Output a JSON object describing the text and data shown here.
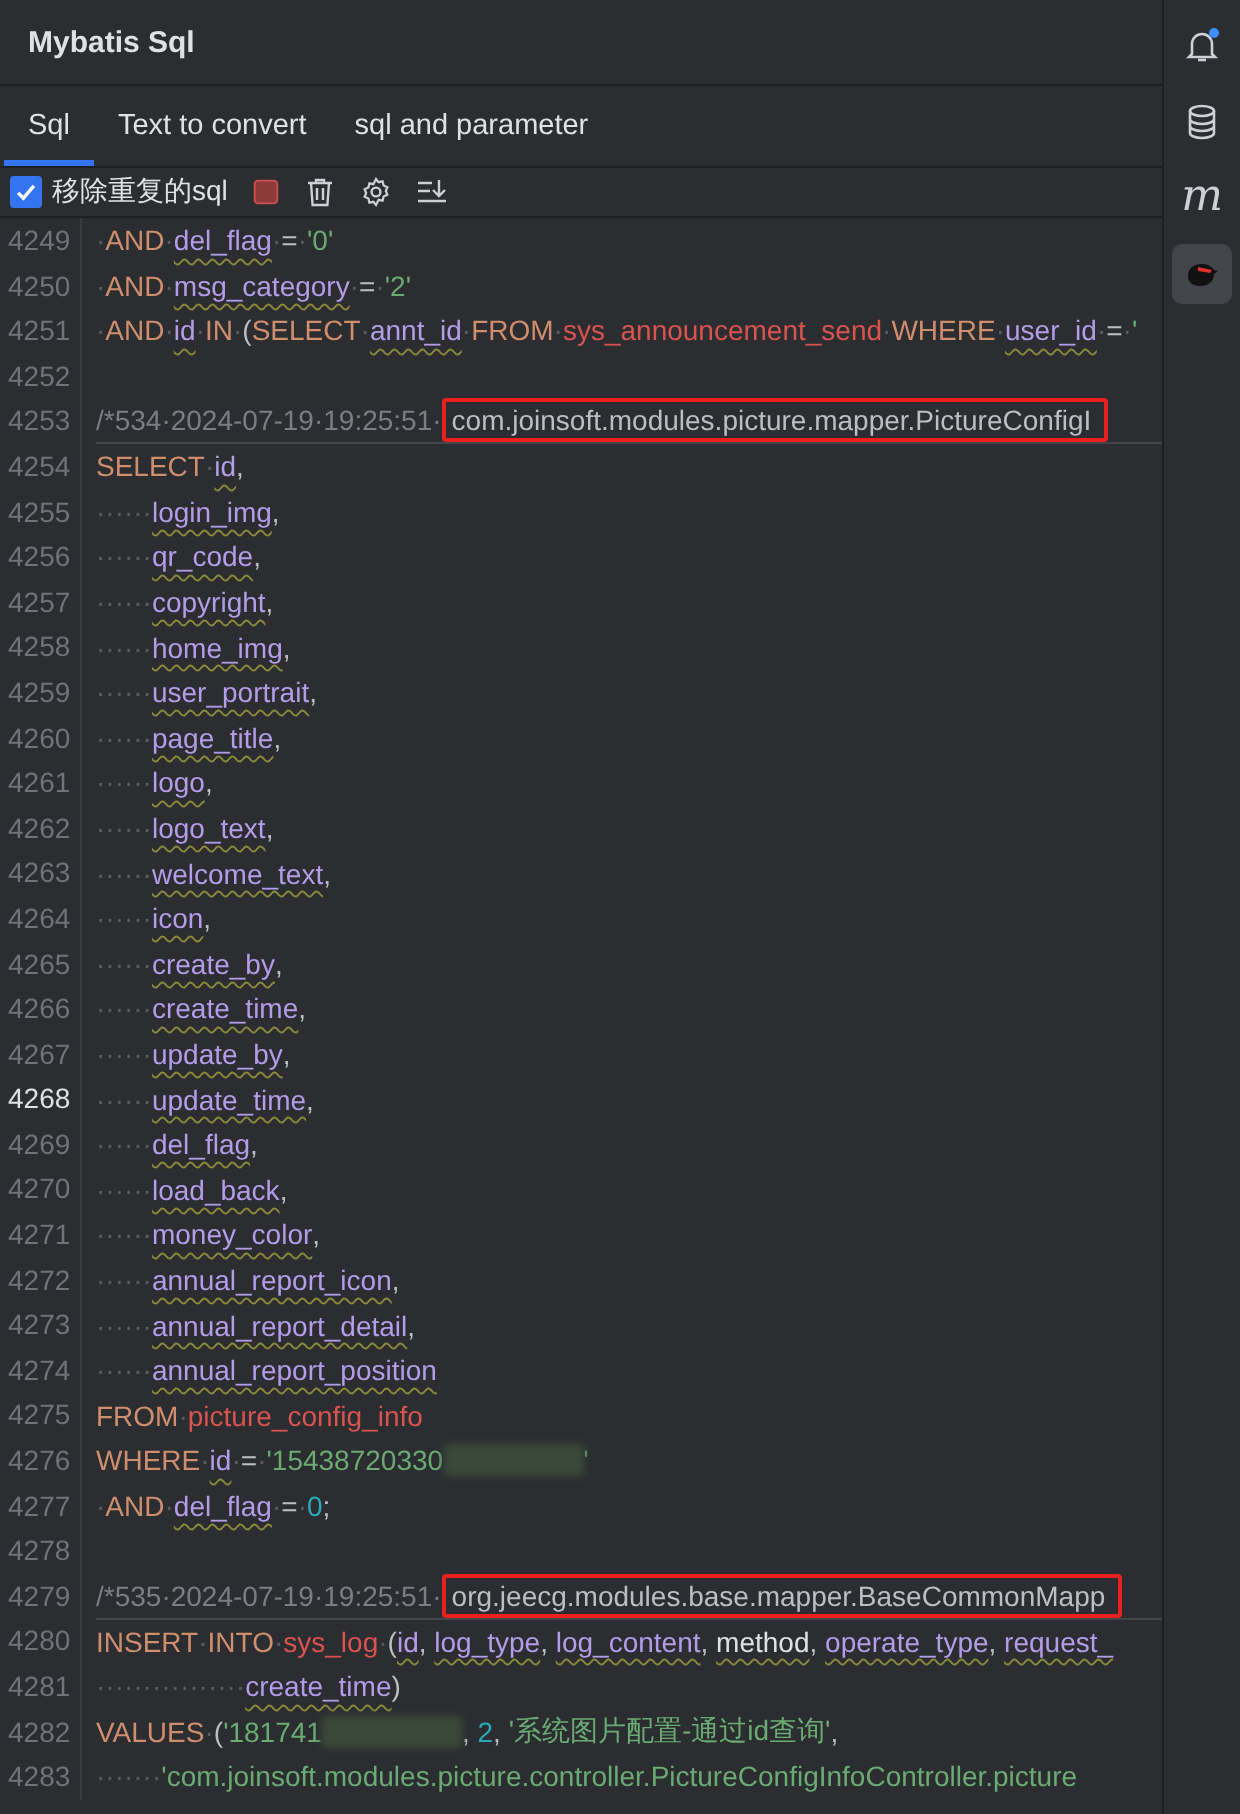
{
  "panel": {
    "title": "Mybatis Sql"
  },
  "tabs": [
    {
      "label": "Sql",
      "selected": true
    },
    {
      "label": "Text to convert",
      "selected": false
    },
    {
      "label": "sql and parameter",
      "selected": false
    }
  ],
  "toolbar": {
    "remove_duplicates": {
      "label": "移除重复的sql",
      "checked": true
    }
  },
  "side_strip": {
    "bell_badge": true,
    "items": [
      {
        "kind": "bell",
        "selected": false
      },
      {
        "kind": "database",
        "selected": false
      },
      {
        "kind": "letter",
        "text": "m",
        "selected": false
      },
      {
        "kind": "bird",
        "selected": true
      }
    ]
  },
  "lines": [
    {
      "number": "4249",
      "current": false,
      "boxed": false,
      "tokens": [
        {
          "kind": "ws",
          "text": "·"
        },
        {
          "kind": "kw",
          "text": "AND"
        },
        {
          "kind": "ws",
          "text": "·"
        },
        {
          "kind": "id",
          "text": "del_flag"
        },
        {
          "kind": "ws",
          "text": "·"
        },
        {
          "kind": "op",
          "text": "="
        },
        {
          "kind": "ws",
          "text": "·"
        },
        {
          "kind": "str",
          "text": "'0'"
        }
      ]
    },
    {
      "number": "4250",
      "current": false,
      "boxed": false,
      "tokens": [
        {
          "kind": "ws",
          "text": "·"
        },
        {
          "kind": "kw",
          "text": "AND"
        },
        {
          "kind": "ws",
          "text": "·"
        },
        {
          "kind": "id",
          "text": "msg_category"
        },
        {
          "kind": "ws",
          "text": "·"
        },
        {
          "kind": "op",
          "text": "="
        },
        {
          "kind": "ws",
          "text": "·"
        },
        {
          "kind": "str",
          "text": "'2'"
        }
      ]
    },
    {
      "number": "4251",
      "current": false,
      "boxed": false,
      "tokens": [
        {
          "kind": "ws",
          "text": "·"
        },
        {
          "kind": "kw",
          "text": "AND"
        },
        {
          "kind": "ws",
          "text": "·"
        },
        {
          "kind": "id",
          "text": "id"
        },
        {
          "kind": "ws",
          "text": "·"
        },
        {
          "kind": "kw",
          "text": "IN"
        },
        {
          "kind": "ws",
          "text": "·"
        },
        {
          "kind": "op",
          "text": "("
        },
        {
          "kind": "kw",
          "text": "SELECT"
        },
        {
          "kind": "ws",
          "text": "·"
        },
        {
          "kind": "id",
          "text": "annt_id"
        },
        {
          "kind": "ws",
          "text": "·"
        },
        {
          "kind": "kw",
          "text": "FROM"
        },
        {
          "kind": "ws",
          "text": "·"
        },
        {
          "kind": "table",
          "text": "sys_announcement_send"
        },
        {
          "kind": "ws",
          "text": "·"
        },
        {
          "kind": "kw",
          "text": "WHERE"
        },
        {
          "kind": "ws",
          "text": "·"
        },
        {
          "kind": "id",
          "text": "user_id"
        },
        {
          "kind": "ws",
          "text": "·"
        },
        {
          "kind": "op",
          "text": "="
        },
        {
          "kind": "ws",
          "text": "·"
        },
        {
          "kind": "str",
          "text": "'"
        }
      ]
    },
    {
      "number": "4252",
      "current": false
    },
    {
      "number": "4253",
      "current": false,
      "boxed": true,
      "tokens": [
        {
          "kind": "comment",
          "text": "/*534·2024-07-19·19:25:51·"
        },
        {
          "kind": "boxed",
          "text": "com.joinsoft.modules.picture.mapper.PictureConfigI"
        }
      ]
    },
    {
      "number": "4254",
      "current": false,
      "boxed": false,
      "tokens": [
        {
          "kind": "kw",
          "text": "SELECT"
        },
        {
          "kind": "ws",
          "text": "·"
        },
        {
          "kind": "id",
          "text": "id"
        },
        {
          "kind": "op",
          "text": ","
        }
      ]
    },
    {
      "number": "4255",
      "current": false,
      "boxed": false,
      "tokens": [
        {
          "kind": "ws",
          "text": "······"
        },
        {
          "kind": "id",
          "text": "login_img"
        },
        {
          "kind": "op",
          "text": ","
        }
      ]
    },
    {
      "number": "4256",
      "current": false,
      "boxed": false,
      "tokens": [
        {
          "kind": "ws",
          "text": "······"
        },
        {
          "kind": "id",
          "text": "qr_code"
        },
        {
          "kind": "op",
          "text": ","
        }
      ]
    },
    {
      "number": "4257",
      "current": false,
      "boxed": false,
      "tokens": [
        {
          "kind": "ws",
          "text": "······"
        },
        {
          "kind": "id",
          "text": "copyright"
        },
        {
          "kind": "op",
          "text": ","
        }
      ]
    },
    {
      "number": "4258",
      "current": false,
      "boxed": false,
      "tokens": [
        {
          "kind": "ws",
          "text": "······"
        },
        {
          "kind": "id",
          "text": "home_img"
        },
        {
          "kind": "op",
          "text": ","
        }
      ]
    },
    {
      "number": "4259",
      "current": false,
      "boxed": false,
      "tokens": [
        {
          "kind": "ws",
          "text": "······"
        },
        {
          "kind": "id",
          "text": "user_portrait"
        },
        {
          "kind": "op",
          "text": ","
        }
      ]
    },
    {
      "number": "4260",
      "current": false,
      "boxed": false,
      "tokens": [
        {
          "kind": "ws",
          "text": "······"
        },
        {
          "kind": "id",
          "text": "page_title"
        },
        {
          "kind": "op",
          "text": ","
        }
      ]
    },
    {
      "number": "4261",
      "current": false,
      "boxed": false,
      "tokens": [
        {
          "kind": "ws",
          "text": "······"
        },
        {
          "kind": "id",
          "text": "logo"
        },
        {
          "kind": "op",
          "text": ","
        }
      ]
    },
    {
      "number": "4262",
      "current": false,
      "boxed": false,
      "tokens": [
        {
          "kind": "ws",
          "text": "······"
        },
        {
          "kind": "id",
          "text": "logo_text"
        },
        {
          "kind": "op",
          "text": ","
        }
      ]
    },
    {
      "number": "4263",
      "current": false,
      "boxed": false,
      "tokens": [
        {
          "kind": "ws",
          "text": "······"
        },
        {
          "kind": "id",
          "text": "welcome_text"
        },
        {
          "kind": "op",
          "text": ","
        }
      ]
    },
    {
      "number": "4264",
      "current": false,
      "boxed": false,
      "tokens": [
        {
          "kind": "ws",
          "text": "······"
        },
        {
          "kind": "id",
          "text": "icon"
        },
        {
          "kind": "op",
          "text": ","
        }
      ]
    },
    {
      "number": "4265",
      "current": false,
      "boxed": false,
      "tokens": [
        {
          "kind": "ws",
          "text": "······"
        },
        {
          "kind": "id",
          "text": "create_by"
        },
        {
          "kind": "op",
          "text": ","
        }
      ]
    },
    {
      "number": "4266",
      "current": false,
      "boxed": false,
      "tokens": [
        {
          "kind": "ws",
          "text": "······"
        },
        {
          "kind": "id",
          "text": "create_time"
        },
        {
          "kind": "op",
          "text": ","
        }
      ]
    },
    {
      "number": "4267",
      "current": false,
      "boxed": false,
      "tokens": [
        {
          "kind": "ws",
          "text": "······"
        },
        {
          "kind": "id",
          "text": "update_by"
        },
        {
          "kind": "op",
          "text": ","
        }
      ]
    },
    {
      "number": "4268",
      "current": true,
      "boxed": false,
      "tokens": [
        {
          "kind": "ws",
          "text": "······"
        },
        {
          "kind": "id",
          "text": "update_time"
        },
        {
          "kind": "op",
          "text": ","
        }
      ]
    },
    {
      "number": "4269",
      "current": false,
      "boxed": false,
      "tokens": [
        {
          "kind": "ws",
          "text": "······"
        },
        {
          "kind": "id",
          "text": "del_flag"
        },
        {
          "kind": "op",
          "text": ","
        }
      ]
    },
    {
      "number": "4270",
      "current": false,
      "boxed": false,
      "tokens": [
        {
          "kind": "ws",
          "text": "······"
        },
        {
          "kind": "id",
          "text": "load_back"
        },
        {
          "kind": "op",
          "text": ","
        }
      ]
    },
    {
      "number": "4271",
      "current": false,
      "boxed": false,
      "tokens": [
        {
          "kind": "ws",
          "text": "······"
        },
        {
          "kind": "id",
          "text": "money_color"
        },
        {
          "kind": "op",
          "text": ","
        }
      ]
    },
    {
      "number": "4272",
      "current": false,
      "boxed": false,
      "tokens": [
        {
          "kind": "ws",
          "text": "······"
        },
        {
          "kind": "id",
          "text": "annual_report_icon"
        },
        {
          "kind": "op",
          "text": ","
        }
      ]
    },
    {
      "number": "4273",
      "current": false,
      "boxed": false,
      "tokens": [
        {
          "kind": "ws",
          "text": "······"
        },
        {
          "kind": "id",
          "text": "annual_report_detail"
        },
        {
          "kind": "op",
          "text": ","
        }
      ]
    },
    {
      "number": "4274",
      "current": false,
      "boxed": false,
      "tokens": [
        {
          "kind": "ws",
          "text": "······"
        },
        {
          "kind": "id",
          "text": "annual_report_position"
        }
      ]
    },
    {
      "number": "4275",
      "current": false,
      "boxed": false,
      "tokens": [
        {
          "kind": "kw",
          "text": "FROM"
        },
        {
          "kind": "ws",
          "text": "·"
        },
        {
          "kind": "table",
          "text": "picture_config_info"
        }
      ]
    },
    {
      "number": "4276",
      "current": false,
      "boxed": false,
      "tokens": [
        {
          "kind": "kw",
          "text": "WHERE"
        },
        {
          "kind": "ws",
          "text": "·"
        },
        {
          "kind": "id",
          "text": "id"
        },
        {
          "kind": "ws",
          "text": "·"
        },
        {
          "kind": "op",
          "text": "="
        },
        {
          "kind": "ws",
          "text": "·"
        },
        {
          "kind": "str",
          "text": "'15438720330"
        },
        {
          "kind": "redacted"
        },
        {
          "kind": "str",
          "text": "'"
        }
      ]
    },
    {
      "number": "4277",
      "current": false,
      "boxed": false,
      "tokens": [
        {
          "kind": "ws",
          "text": "·"
        },
        {
          "kind": "kw",
          "text": "AND"
        },
        {
          "kind": "ws",
          "text": "·"
        },
        {
          "kind": "id",
          "text": "del_flag"
        },
        {
          "kind": "ws",
          "text": "·"
        },
        {
          "kind": "op",
          "text": "="
        },
        {
          "kind": "ws",
          "text": "·"
        },
        {
          "kind": "num",
          "text": "0"
        },
        {
          "kind": "op",
          "text": ";"
        }
      ]
    },
    {
      "number": "4278",
      "current": false
    },
    {
      "number": "4279",
      "current": false,
      "boxed": true,
      "tokens": [
        {
          "kind": "comment",
          "text": "/*535·2024-07-19·19:25:51·"
        },
        {
          "kind": "boxed",
          "text": "org.jeecg.modules.base.mapper.BaseCommonMapp"
        }
      ]
    },
    {
      "number": "4280",
      "current": false,
      "boxed": false,
      "tokens": [
        {
          "kind": "kw",
          "text": "INSERT"
        },
        {
          "kind": "ws",
          "text": "·"
        },
        {
          "kind": "kw",
          "text": "INTO"
        },
        {
          "kind": "ws",
          "text": "·"
        },
        {
          "kind": "table",
          "text": "sys_log"
        },
        {
          "kind": "ws",
          "text": "·"
        },
        {
          "kind": "op",
          "text": "("
        },
        {
          "kind": "id",
          "text": "id"
        },
        {
          "kind": "op",
          "text": ", "
        },
        {
          "kind": "id",
          "text": "log_type"
        },
        {
          "kind": "op",
          "text": ", "
        },
        {
          "kind": "id",
          "text": "log_content"
        },
        {
          "kind": "op",
          "text": ", "
        },
        {
          "kind": "plainid",
          "text": "method"
        },
        {
          "kind": "op",
          "text": ", "
        },
        {
          "kind": "id",
          "text": "operate_type"
        },
        {
          "kind": "op",
          "text": ", "
        },
        {
          "kind": "id",
          "text": "request_"
        }
      ]
    },
    {
      "number": "4281",
      "current": false,
      "boxed": false,
      "tokens": [
        {
          "kind": "ws",
          "text": "················"
        },
        {
          "kind": "id",
          "text": "create_time"
        },
        {
          "kind": "op",
          "text": ")"
        }
      ]
    },
    {
      "number": "4282",
      "current": false,
      "boxed": false,
      "tokens": [
        {
          "kind": "kw",
          "text": "VALUES"
        },
        {
          "kind": "ws",
          "text": "·"
        },
        {
          "kind": "op",
          "text": "("
        },
        {
          "kind": "str",
          "text": "'181741"
        },
        {
          "kind": "redacted"
        },
        {
          "kind": "op",
          "text": ", "
        },
        {
          "kind": "num",
          "text": "2"
        },
        {
          "kind": "op",
          "text": ", "
        },
        {
          "kind": "str",
          "text": "'系统图片配置-通过id查询'"
        },
        {
          "kind": "op",
          "text": ","
        }
      ]
    },
    {
      "number": "4283",
      "current": false,
      "boxed": false,
      "tokens": [
        {
          "kind": "ws",
          "text": "·······"
        },
        {
          "kind": "str",
          "text": "'com.joinsoft.modules.picture.controller.PictureConfigInfoController.picture"
        }
      ]
    }
  ]
}
